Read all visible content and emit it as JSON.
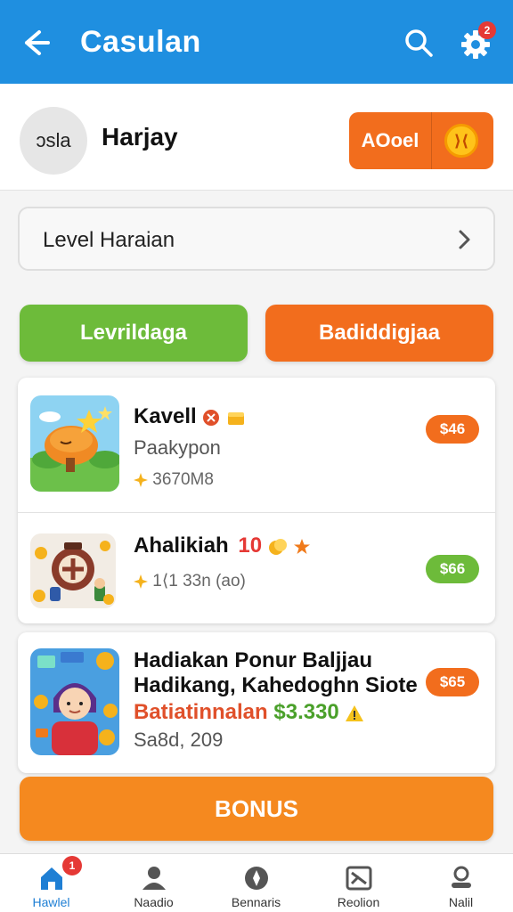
{
  "header": {
    "title": "Casulan",
    "notification_count": "2"
  },
  "profile": {
    "avatar_text": "ɔsla",
    "username": "Harjay",
    "add_button_label": "AOoel"
  },
  "level_row": {
    "label": "Level Haraian"
  },
  "actions": {
    "left_label": "Levrildaga",
    "right_label": "Badiddigjaa"
  },
  "items": [
    {
      "name": "Kavell",
      "subtitle": "Paakypon",
      "meta": "3670M8",
      "price": "$46"
    },
    {
      "name": "Ahalikiah",
      "highlight": "10",
      "meta": "1⟨1 33n (ao)",
      "price": "$66"
    }
  ],
  "featured": {
    "line1": "Hadiakan Ponur Baljjau",
    "line2": "Hadikang, Kahedoghn Siote",
    "line3_prefix": "Batiatinnalan",
    "line3_amount": "$3.330",
    "line4": "Sa8d, 209",
    "price": "$65"
  },
  "bonus_button_label": "BONUS",
  "bottom_nav": {
    "items": [
      {
        "label": "Hawlel",
        "badge": "1"
      },
      {
        "label": "Naadio"
      },
      {
        "label": "Bennaris"
      },
      {
        "label": "Reolion"
      },
      {
        "label": "Nalil"
      }
    ]
  },
  "colors": {
    "header_blue": "#1f8fe0",
    "accent_orange": "#f26d1d",
    "accent_green": "#6dbb3a",
    "bonus_orange": "#f5891f",
    "badge_red": "#e53935"
  }
}
